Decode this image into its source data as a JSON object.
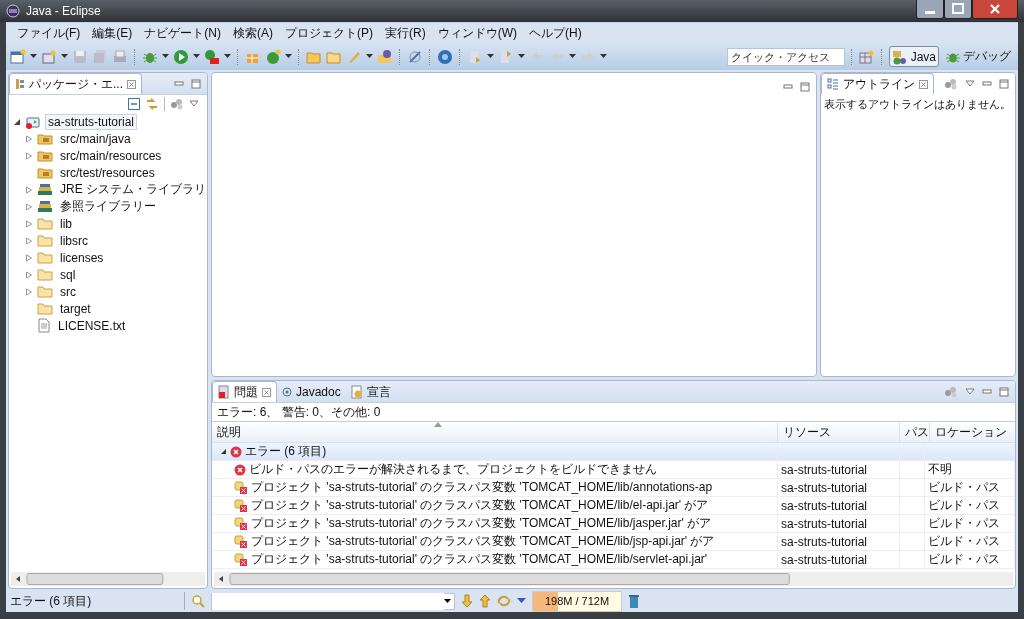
{
  "window": {
    "title": "Java - Eclipse"
  },
  "menu": [
    "ファイル(F)",
    "編集(E)",
    "ナビゲート(N)",
    "検索(A)",
    "プロジェクト(P)",
    "実行(R)",
    "ウィンドウ(W)",
    "ヘルプ(H)"
  ],
  "quick_access": {
    "placeholder": "クイック・アクセス"
  },
  "perspectives": [
    {
      "label": "Java",
      "kind": "java",
      "selected": true
    },
    {
      "label": "デバッグ",
      "kind": "debug",
      "selected": false
    }
  ],
  "package_explorer": {
    "tab": {
      "label": "パッケージ・エ...",
      "selected": true
    },
    "tree": [
      {
        "label": "sa-struts-tutorial",
        "kind": "project",
        "expanded": true,
        "selected": true,
        "children": [
          {
            "label": "src/main/java",
            "kind": "source",
            "expanded": false,
            "selected": false
          },
          {
            "label": "src/main/resources",
            "kind": "source",
            "expanded": false,
            "selected": false
          },
          {
            "label": "src/test/resources",
            "kind": "source",
            "selected": false
          },
          {
            "label": "JRE システム・ライブラリ",
            "kind": "library",
            "expanded": false,
            "selected": false
          },
          {
            "label": "参照ライブラリー",
            "kind": "library",
            "expanded": false,
            "selected": false
          },
          {
            "label": "lib",
            "kind": "folder",
            "expanded": false,
            "selected": false
          },
          {
            "label": "libsrc",
            "kind": "folder",
            "expanded": false,
            "selected": false
          },
          {
            "label": "licenses",
            "kind": "folder",
            "expanded": false,
            "selected": false
          },
          {
            "label": "sql",
            "kind": "folder",
            "expanded": false,
            "selected": false
          },
          {
            "label": "src",
            "kind": "folder",
            "expanded": false,
            "selected": false
          },
          {
            "label": "target",
            "kind": "folder",
            "selected": false
          },
          {
            "label": "LICENSE.txt",
            "kind": "file",
            "selected": false
          }
        ]
      }
    ]
  },
  "outline": {
    "tab": {
      "label": "アウトライン",
      "selected": true
    },
    "message": "表示するアウトラインはありません。"
  },
  "problems": {
    "tabs": [
      {
        "label": "問題",
        "kind": "problems",
        "selected": true
      },
      {
        "label": "Javadoc",
        "kind": "javadoc",
        "selected": false
      },
      {
        "label": "宣言",
        "kind": "declaration",
        "selected": false
      }
    ],
    "summary": "エラー: 6、 警告: 0、その他: 0",
    "columns": [
      "説明",
      "リソース",
      "パス",
      "ロケーション"
    ],
    "groups": [
      {
        "label": "エラー (6 項目)",
        "expanded": true,
        "selected": true,
        "rows": [
          {
            "kind": "error",
            "description": "ビルド・パスのエラーが解決されるまで、プロジェクトをビルドできません",
            "resource": "sa-struts-tutorial",
            "location": "不明"
          },
          {
            "kind": "buildpath",
            "description": "プロジェクト 'sa-struts-tutorial' のクラスパス変数 'TOMCAT_HOME/lib/annotations-ap",
            "resource": "sa-struts-tutorial",
            "location": "ビルド・パス"
          },
          {
            "kind": "buildpath",
            "description": "プロジェクト 'sa-struts-tutorial' のクラスパス変数 'TOMCAT_HOME/lib/el-api.jar' がア",
            "resource": "sa-struts-tutorial",
            "location": "ビルド・パス"
          },
          {
            "kind": "buildpath",
            "description": "プロジェクト 'sa-struts-tutorial' のクラスパス変数 'TOMCAT_HOME/lib/jasper.jar' がア",
            "resource": "sa-struts-tutorial",
            "location": "ビルド・パス"
          },
          {
            "kind": "buildpath",
            "description": "プロジェクト 'sa-struts-tutorial' のクラスパス変数 'TOMCAT_HOME/lib/jsp-api.jar' がア",
            "resource": "sa-struts-tutorial",
            "location": "ビルド・パス"
          },
          {
            "kind": "buildpath",
            "description": "プロジェクト 'sa-struts-tutorial' のクラスパス変数 'TOMCAT_HOME/lib/servlet-api.jar'",
            "resource": "sa-struts-tutorial",
            "location": "ビルド・パス"
          }
        ]
      }
    ]
  },
  "status_bar": {
    "message": "エラー (6 項目)",
    "memory": {
      "reading": "198M / 712M",
      "level": 0.28
    }
  }
}
